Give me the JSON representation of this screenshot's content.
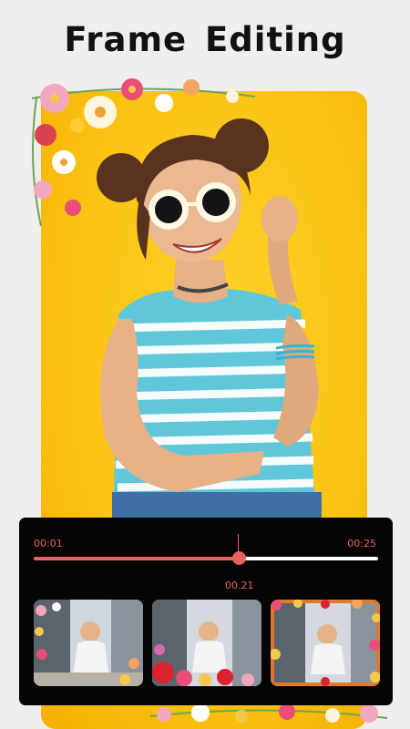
{
  "header": {
    "title": "Frame Editing"
  },
  "timeline": {
    "start_time": "00:01",
    "end_time": "00:25",
    "current_time": "00.21",
    "progress": 0.6
  },
  "thumbnails": [
    {
      "frame_style": "floral-left"
    },
    {
      "frame_style": "floral-bottom"
    },
    {
      "frame_style": "floral-border"
    }
  ],
  "colors": {
    "accent": "#e8625f",
    "background": "#efedee",
    "photo_background": "#fbc313",
    "panel": "#050505"
  }
}
